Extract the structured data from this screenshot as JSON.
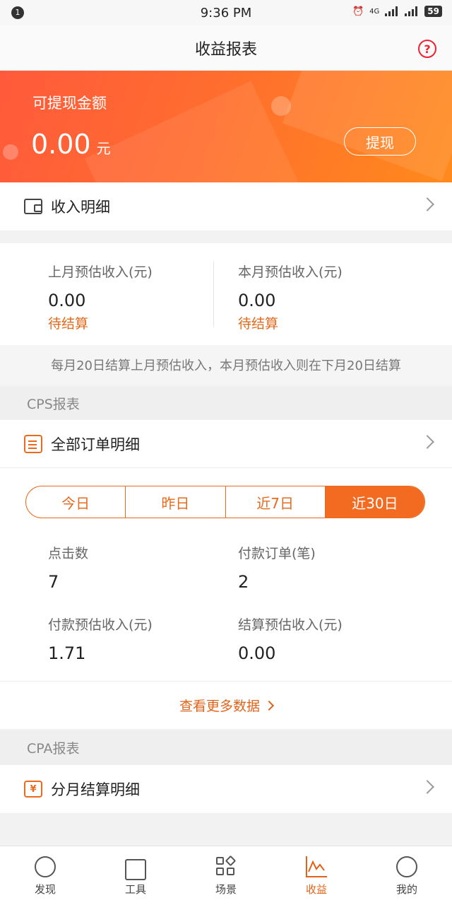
{
  "status_bar": {
    "time": "9:36 PM",
    "notification_count": "1",
    "network": "4G",
    "battery": "59"
  },
  "header": {
    "title": "收益报表",
    "help": "?"
  },
  "balance": {
    "label": "可提现金额",
    "amount": "0.00",
    "unit": "元",
    "withdraw_label": "提现"
  },
  "income_detail": {
    "label": "收入明细"
  },
  "estimates": {
    "last_month": {
      "title": "上月预估收入(元)",
      "value": "0.00",
      "status": "待结算"
    },
    "this_month": {
      "title": "本月预估收入(元)",
      "value": "0.00",
      "status": "待结算"
    }
  },
  "notice": "每月20日结算上月预估收入，本月预估收入则在下月20日结算",
  "cps": {
    "header": "CPS报表",
    "orders_label": "全部订单明细",
    "tabs": [
      {
        "label": "今日",
        "active": false
      },
      {
        "label": "昨日",
        "active": false
      },
      {
        "label": "近7日",
        "active": false
      },
      {
        "label": "近30日",
        "active": true
      }
    ],
    "stats": {
      "clicks": {
        "title": "点击数",
        "value": "7"
      },
      "paid_orders": {
        "title": "付款订单(笔)",
        "value": "2"
      },
      "paid_est_income": {
        "title": "付款预估收入(元)",
        "value": "1.71"
      },
      "settled_est_income": {
        "title": "结算预估收入(元)",
        "value": "0.00"
      }
    },
    "more_label": "查看更多数据"
  },
  "cpa": {
    "header": "CPA报表",
    "monthly_label": "分月结算明细"
  },
  "bottom_nav": [
    {
      "label": "发现",
      "icon": "bulb-icon",
      "active": false
    },
    {
      "label": "工具",
      "icon": "briefcase-icon",
      "active": false
    },
    {
      "label": "场景",
      "icon": "grid-icon",
      "active": false
    },
    {
      "label": "收益",
      "icon": "chart-icon",
      "active": true
    },
    {
      "label": "我的",
      "icon": "profile-icon",
      "active": false
    }
  ],
  "colors": {
    "accent": "#f36a21",
    "banner_start": "#ff5a3c",
    "banner_end": "#ff8a1c"
  }
}
